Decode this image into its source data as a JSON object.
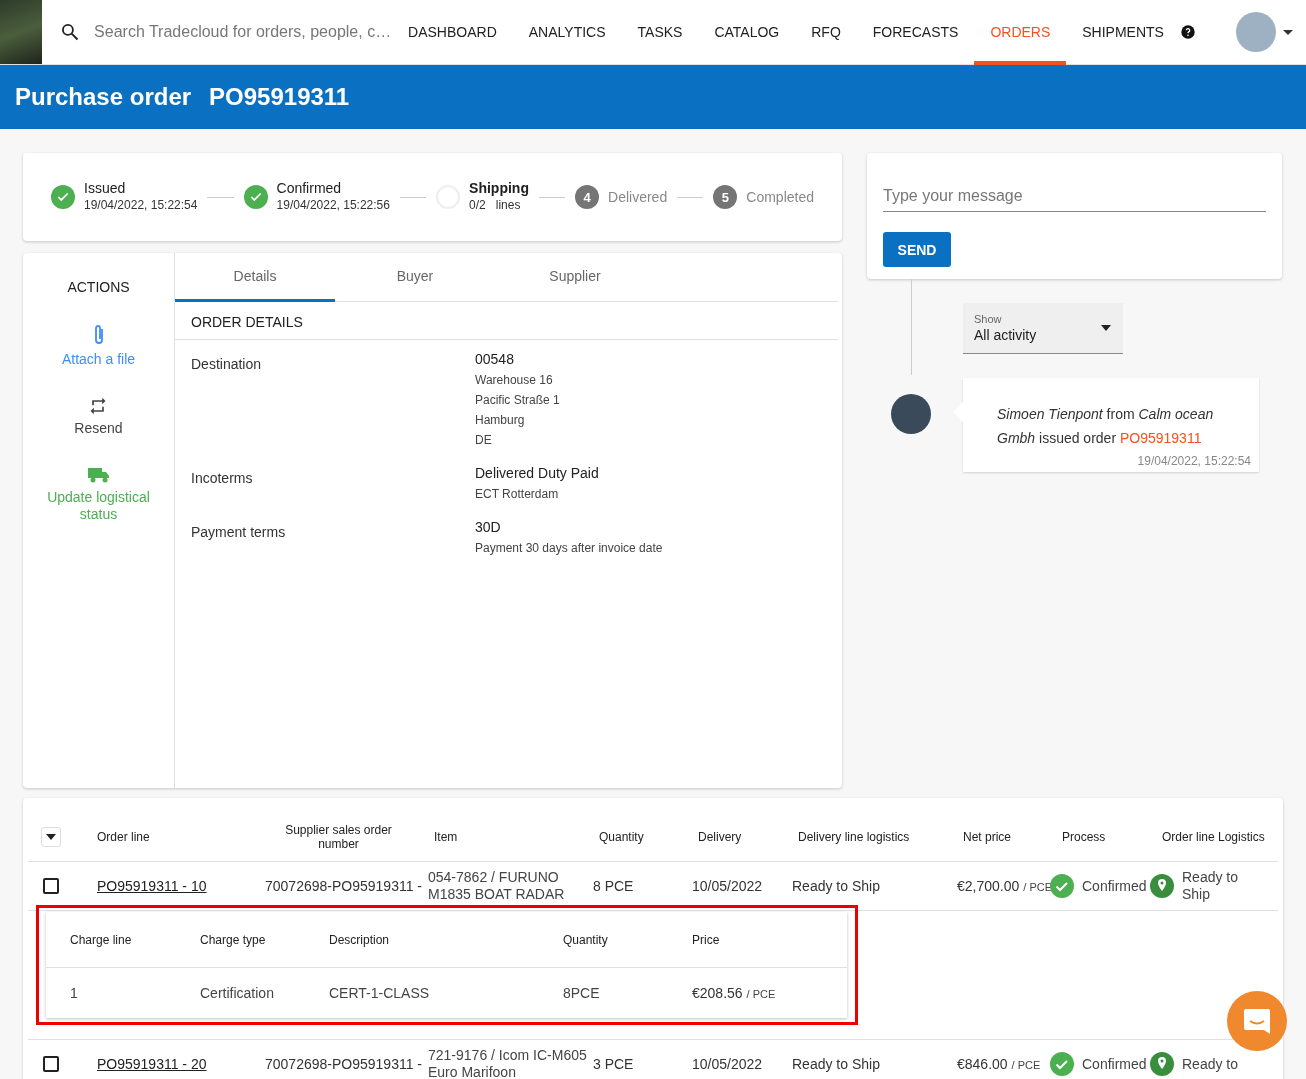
{
  "nav": {
    "search_placeholder": "Search Tradecloud for orders, people, c…",
    "items": [
      {
        "label": "DASHBOARD",
        "selected": false
      },
      {
        "label": "ANALYTICS",
        "selected": false
      },
      {
        "label": "TASKS",
        "selected": false
      },
      {
        "label": "CATALOG",
        "selected": false
      },
      {
        "label": "RFQ",
        "selected": false
      },
      {
        "label": "FORECASTS",
        "selected": false
      },
      {
        "label": "ORDERS",
        "selected": true
      },
      {
        "label": "SHIPMENTS",
        "selected": false
      }
    ]
  },
  "header": {
    "title": "Purchase order",
    "order_number": "PO95919311"
  },
  "progress": [
    {
      "kind": "done",
      "label": "Issued",
      "sub": "19/04/2022, 15:22:54"
    },
    {
      "kind": "done",
      "label": "Confirmed",
      "sub": "19/04/2022, 15:22:56"
    },
    {
      "kind": "active",
      "label": "Shipping",
      "count": "0/2",
      "unit": "lines"
    },
    {
      "kind": "pending",
      "number": "4",
      "label": "Delivered"
    },
    {
      "kind": "pending",
      "number": "5",
      "label": "Completed"
    }
  ],
  "actions": {
    "title": "ACTIONS",
    "items": [
      {
        "kind": "attach",
        "label": "Attach a file"
      },
      {
        "kind": "resend",
        "label": "Resend"
      },
      {
        "kind": "logistics",
        "label": "Update logistical status"
      }
    ]
  },
  "tabs": [
    {
      "label": "Details",
      "selected": true
    },
    {
      "label": "Buyer",
      "selected": false
    },
    {
      "label": "Supplier",
      "selected": false
    }
  ],
  "order_details": {
    "title": "ORDER DETAILS",
    "fields": [
      {
        "label": "Destination",
        "value": "00548",
        "lines": [
          "Warehouse 16",
          "Pacific Straße 1",
          "Hamburg",
          "DE"
        ]
      },
      {
        "label": "Incoterms",
        "value": "Delivered Duty Paid",
        "lines": [
          "ECT Rotterdam"
        ]
      },
      {
        "label": "Payment terms",
        "value": "30D",
        "lines": [
          "Payment 30 days after invoice date"
        ]
      }
    ]
  },
  "chat": {
    "placeholder": "Type your message",
    "send": "SEND",
    "filter": {
      "label": "Show",
      "value": "All activity"
    },
    "activity": [
      {
        "text": "*Simoen Tienpont* from *Calm ocean Gmbh* issued order",
        "order": "PO95919311",
        "time": "19/04/2022, 15:22:54"
      }
    ]
  },
  "table": {
    "columns": [
      "Order line",
      "Supplier sales order number",
      "Item",
      "Quantity",
      "Delivery",
      "Delivery line logistics",
      "Net price",
      "Process",
      "Order line Logistics"
    ],
    "rows": [
      {
        "checked": false,
        "order_line": "PO95919311 - 10",
        "supplier_order": "70072698-PO95919311 -",
        "item": [
          "054-7862 / FURUNO",
          "M1835 BOAT RADAR"
        ],
        "quantity": "8 PCE",
        "delivery": "10/05/2022",
        "delivery_logistics": "Ready to Ship",
        "net_price": "€2,700.00",
        "unit": "/ PCE",
        "process": "Confirmed",
        "logistics": "Ready to Ship",
        "charges": {
          "columns": [
            "Charge line",
            "Charge type",
            "Description",
            "Quantity",
            "Price"
          ],
          "rows": [
            {
              "line": "1",
              "type": "Certification",
              "description": "CERT-1-CLASS",
              "quantity": "8PCE",
              "price": "€208.56",
              "unit": "/ PCE"
            }
          ]
        }
      },
      {
        "checked": false,
        "order_line": "PO95919311 - 20",
        "supplier_order": "70072698-PO95919311 -",
        "item": [
          "721-9176 / Icom IC-M605",
          "Euro Marifoon"
        ],
        "quantity": "3 PCE",
        "delivery": "10/05/2022",
        "delivery_logistics": "Ready to Ship",
        "net_price": "€846.00",
        "unit": "/ PCE",
        "process": "Confirmed",
        "logistics": "Ready to"
      }
    ]
  }
}
